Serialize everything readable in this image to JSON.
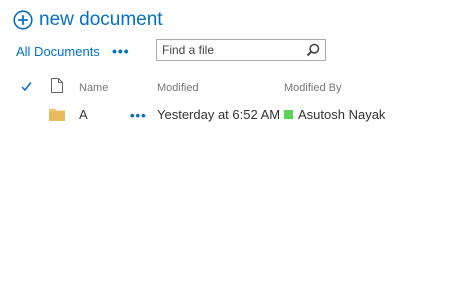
{
  "toolbar": {
    "new_document_label": "new document",
    "view_label": "All Documents",
    "more_label": "•••",
    "search_placeholder": "Find a file"
  },
  "columns": {
    "name": "Name",
    "modified": "Modified",
    "modified_by": "Modified By"
  },
  "rows": [
    {
      "name": "A",
      "more_label": "•••",
      "modified": "Yesterday at 6:52 AM",
      "modified_by": "Asutosh Nayak",
      "type_icon": "folder-icon",
      "presence_status": "online"
    }
  ],
  "colors": {
    "accent": "#0072c6",
    "folder": "#f0c26b",
    "presence_online": "#5dd255"
  }
}
